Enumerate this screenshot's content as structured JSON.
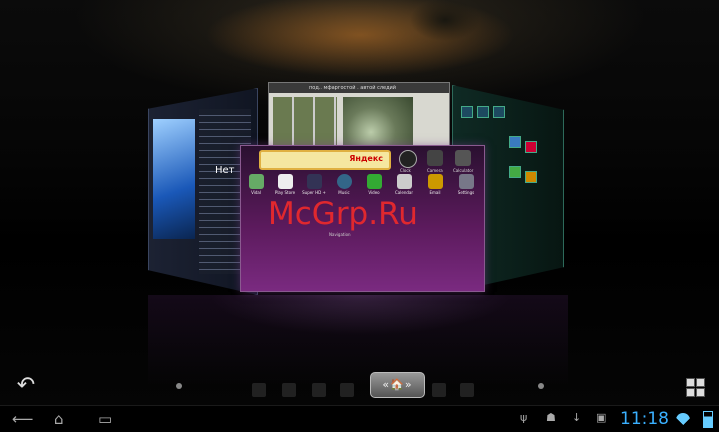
{
  "screen": {
    "watermark": "McGrp.Ru",
    "home_label": "«🏠»",
    "clock": "11:18"
  },
  "panels": {
    "back_header": "под.. мфаргостой . автой следий",
    "left_title": "Нет",
    "front": {
      "search_logo": "Яндекс",
      "top_right_labels": [
        "Clock",
        "Camera",
        "Calculator"
      ],
      "apps": [
        {
          "label": "Vidal",
          "color": "#6a6"
        },
        {
          "label": "Play Store",
          "color": "#eee"
        },
        {
          "label": "Super HD +",
          "color": "#335"
        },
        {
          "label": "Music",
          "color": "#368"
        },
        {
          "label": "Video",
          "color": "#3a3"
        },
        {
          "label": "Calendar",
          "color": "#ccc"
        },
        {
          "label": "Email",
          "color": "#c90"
        },
        {
          "label": "Settings",
          "color": "#778"
        }
      ],
      "folder_label": "Navigation"
    }
  },
  "system_bar": {
    "back_icon": "back-arrow-icon",
    "home_icon": "home-outline-icon",
    "recent_icon": "recent-apps-icon",
    "status_icons": [
      "usb-icon",
      "android-debug-icon",
      "download-icon",
      "bag-icon",
      "sd-card-icon",
      "wifi-icon",
      "battery-icon"
    ]
  },
  "colors": {
    "clock": "#3ab0ff",
    "watermark": "#e0282e",
    "front_panel": "#5b1a5c"
  }
}
